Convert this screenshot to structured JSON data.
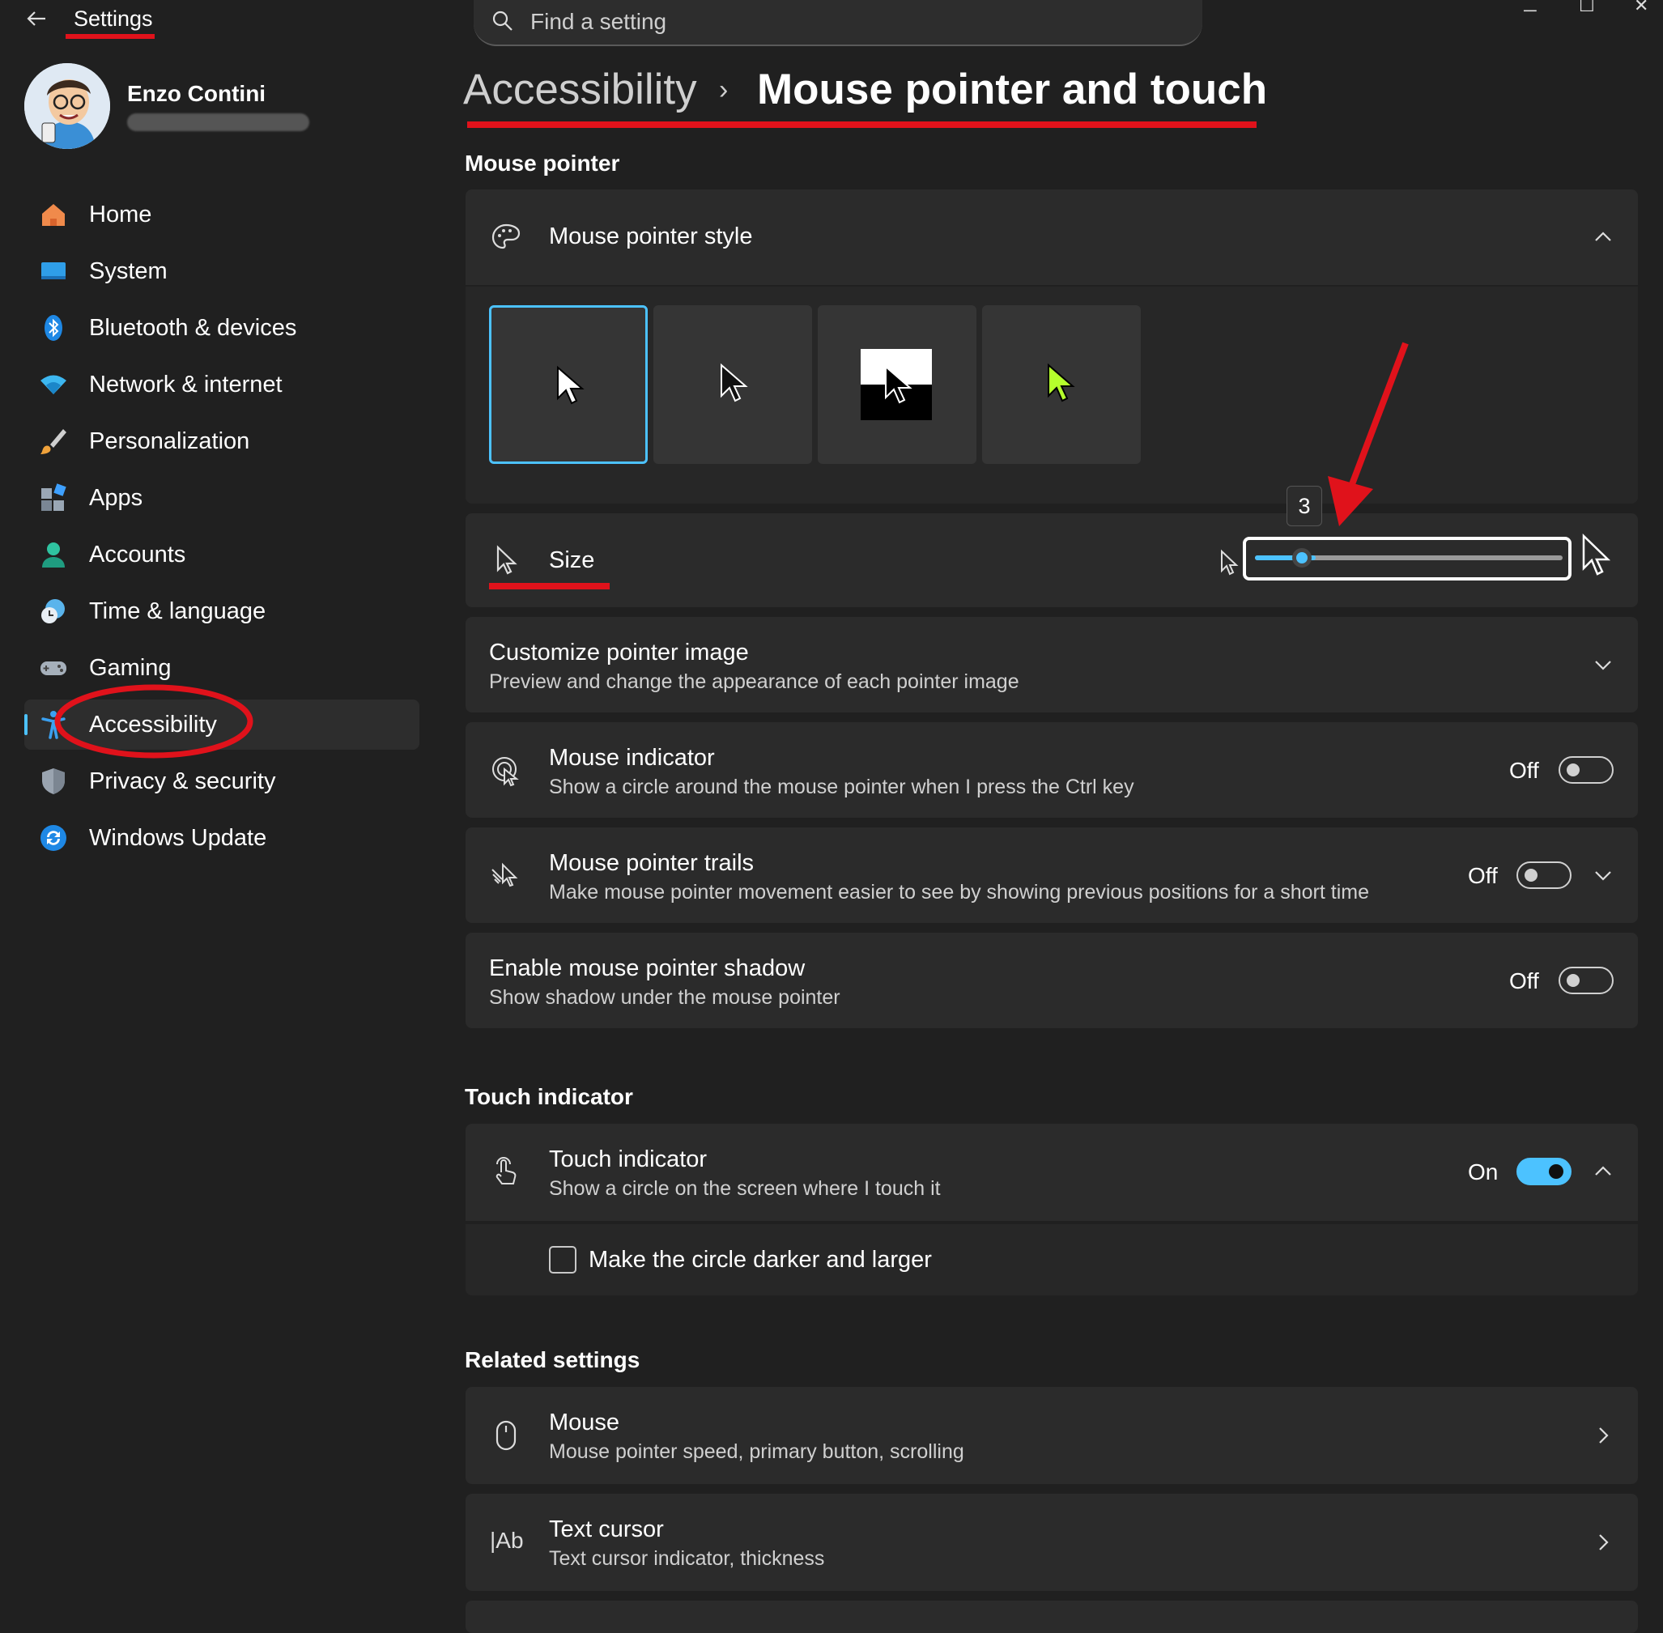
{
  "window": {
    "title": "Settings",
    "minimize": "─",
    "maximize": "☐",
    "close": "✕"
  },
  "search": {
    "placeholder": "Find a setting"
  },
  "user": {
    "name": "Enzo Contini"
  },
  "sidebar": {
    "items": [
      {
        "label": "Home",
        "icon": "home-icon"
      },
      {
        "label": "System",
        "icon": "system-icon"
      },
      {
        "label": "Bluetooth & devices",
        "icon": "bluetooth-icon"
      },
      {
        "label": "Network & internet",
        "icon": "wifi-icon"
      },
      {
        "label": "Personalization",
        "icon": "brush-icon"
      },
      {
        "label": "Apps",
        "icon": "apps-icon"
      },
      {
        "label": "Accounts",
        "icon": "accounts-icon"
      },
      {
        "label": "Time & language",
        "icon": "clock-globe-icon"
      },
      {
        "label": "Gaming",
        "icon": "gamepad-icon"
      },
      {
        "label": "Accessibility",
        "icon": "accessibility-icon",
        "selected": true
      },
      {
        "label": "Privacy & security",
        "icon": "shield-icon"
      },
      {
        "label": "Windows Update",
        "icon": "update-icon"
      }
    ]
  },
  "breadcrumb": {
    "parent": "Accessibility",
    "separator": "›",
    "current": "Mouse pointer and touch"
  },
  "mouse_pointer": {
    "heading": "Mouse pointer",
    "style": {
      "title": "Mouse pointer style",
      "options": [
        "white",
        "black",
        "inverted",
        "custom"
      ],
      "selected": "white"
    },
    "size": {
      "title": "Size",
      "value": "3",
      "min": 1,
      "max": 15
    },
    "customize": {
      "title": "Customize pointer image",
      "subtitle": "Preview and change the appearance of each pointer image"
    },
    "indicator": {
      "title": "Mouse indicator",
      "subtitle": "Show a circle around the mouse pointer when I press the Ctrl key",
      "state": "Off"
    },
    "trails": {
      "title": "Mouse pointer trails",
      "subtitle": "Make mouse pointer movement easier to see by showing previous positions for a short time",
      "state": "Off"
    },
    "shadow": {
      "title": "Enable mouse pointer shadow",
      "subtitle": "Show shadow under the mouse pointer",
      "state": "Off"
    }
  },
  "touch": {
    "heading": "Touch indicator",
    "indicator": {
      "title": "Touch indicator",
      "subtitle": "Show a circle on the screen where I touch it",
      "state": "On"
    },
    "darker": {
      "label": "Make the circle darker and larger",
      "checked": false
    }
  },
  "related": {
    "heading": "Related settings",
    "mouse": {
      "title": "Mouse",
      "subtitle": "Mouse pointer speed, primary button, scrolling"
    },
    "text_cursor": {
      "title": "Text cursor",
      "subtitle": "Text cursor indicator, thickness",
      "icon_text": "|Ab"
    }
  },
  "colors": {
    "accent": "#4cc2ff",
    "annotation": "#e0121b",
    "background": "#202020",
    "card": "#2b2b2b"
  }
}
